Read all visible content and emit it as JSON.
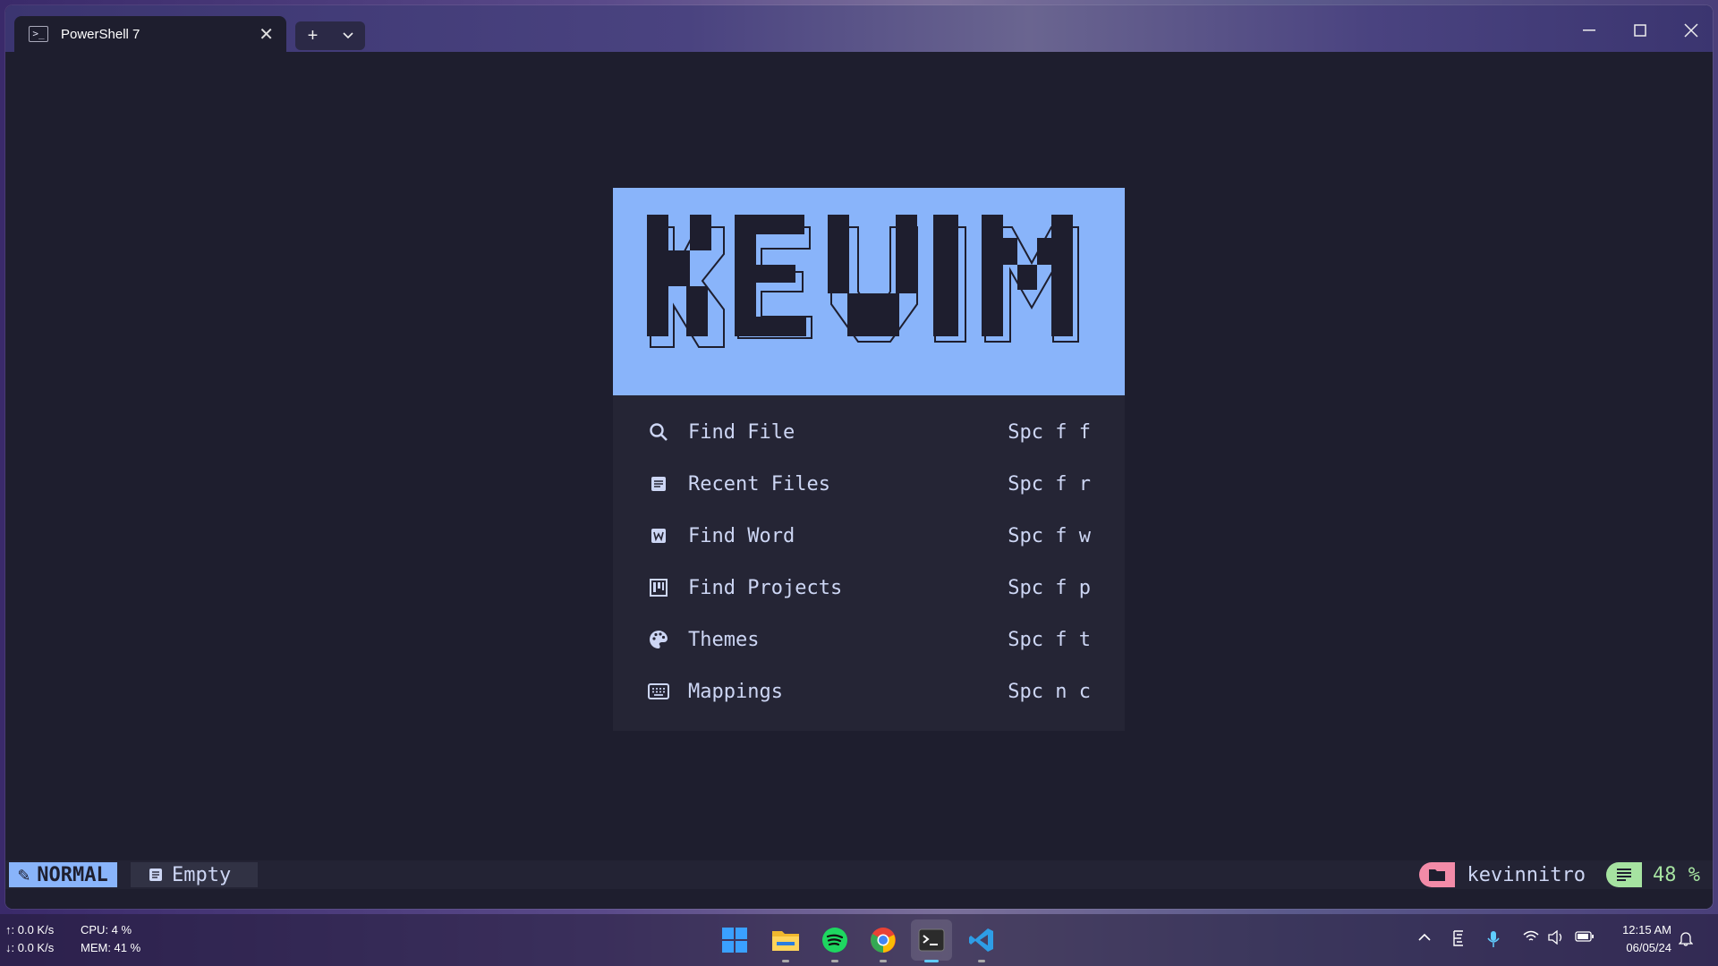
{
  "window": {
    "tab_title": "PowerShell 7",
    "tab_icon": "powershell-icon",
    "new_tab_label": "+",
    "dropdown_label": "⌄"
  },
  "dashboard": {
    "logo_text": "KEVIM",
    "banner_color": "#89b4fa",
    "items": [
      {
        "icon": "search-icon",
        "label": "Find File",
        "key": "Spc f f"
      },
      {
        "icon": "file-icon",
        "label": "Recent Files",
        "key": "Spc f r"
      },
      {
        "icon": "word-icon",
        "label": "Find Word",
        "key": "Spc f w"
      },
      {
        "icon": "projects-icon",
        "label": "Find Projects",
        "key": "Spc f p"
      },
      {
        "icon": "palette-icon",
        "label": "Themes",
        "key": "Spc f t"
      },
      {
        "icon": "keyboard-icon",
        "label": "Mappings",
        "key": "Spc n c"
      }
    ]
  },
  "statusline": {
    "mode": "NORMAL",
    "file": "Empty",
    "directory": "kevinnitro",
    "percent": "48 %"
  },
  "taskbar": {
    "net_up": "↑: 0.0 K/s",
    "net_down": "↓: 0.0 K/s",
    "cpu": "CPU: 4 %",
    "mem": "MEM: 41 %",
    "time": "12:15 AM",
    "date": "06/05/24",
    "apps": [
      "windows-start-icon",
      "file-explorer-icon",
      "spotify-icon",
      "chrome-icon",
      "terminal-icon",
      "vscode-icon"
    ]
  }
}
